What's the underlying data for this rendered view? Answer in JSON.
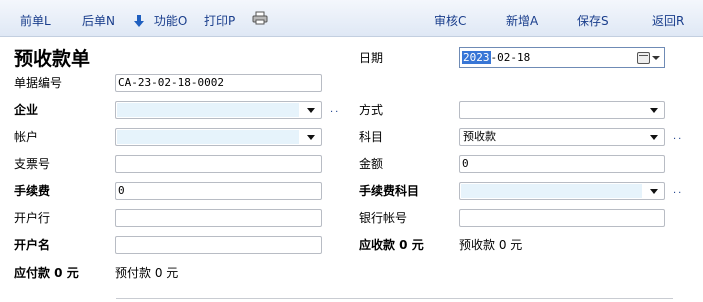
{
  "toolbar": {
    "prev": "前单L",
    "next": "后单N",
    "func": "功能O",
    "print": "打印P",
    "audit": "审核C",
    "add": "新增A",
    "save": "保存S",
    "back": "返回R"
  },
  "form": {
    "title": "预收款单",
    "date_label": "日期",
    "date_highlight": "2023",
    "date_rest": "-02-18",
    "docno_label": "单据编号",
    "docno_value": "CA-23-02-18-0002",
    "enterprise_label": "企业",
    "method_label": "方式",
    "account_label": "帐户",
    "subject_label": "科目",
    "subject_value": "预收款",
    "cheque_label": "支票号",
    "amount_label": "金额",
    "amount_value": "0",
    "fee_label": "手续费",
    "fee_value": "0",
    "fee_subject_label": "手续费科目",
    "bank_label": "开户行",
    "bank_acct_label": "银行帐号",
    "acct_name_label": "开户名",
    "receivable_text": "应收款 0 元",
    "prepaid_text": "预收款 0 元",
    "payable_text": "应付款 0 元",
    "prepay_text": "预付款 0 元"
  },
  "more_dots": "..",
  "icons": [
    "down-arrow-icon",
    "printer-icon",
    "calendar-icon",
    "dropdown-arrow-icon"
  ],
  "colors": {
    "link": "#1a3e8c",
    "select_fill": "#e6f3fb",
    "date_highlight": "#3876d6"
  }
}
